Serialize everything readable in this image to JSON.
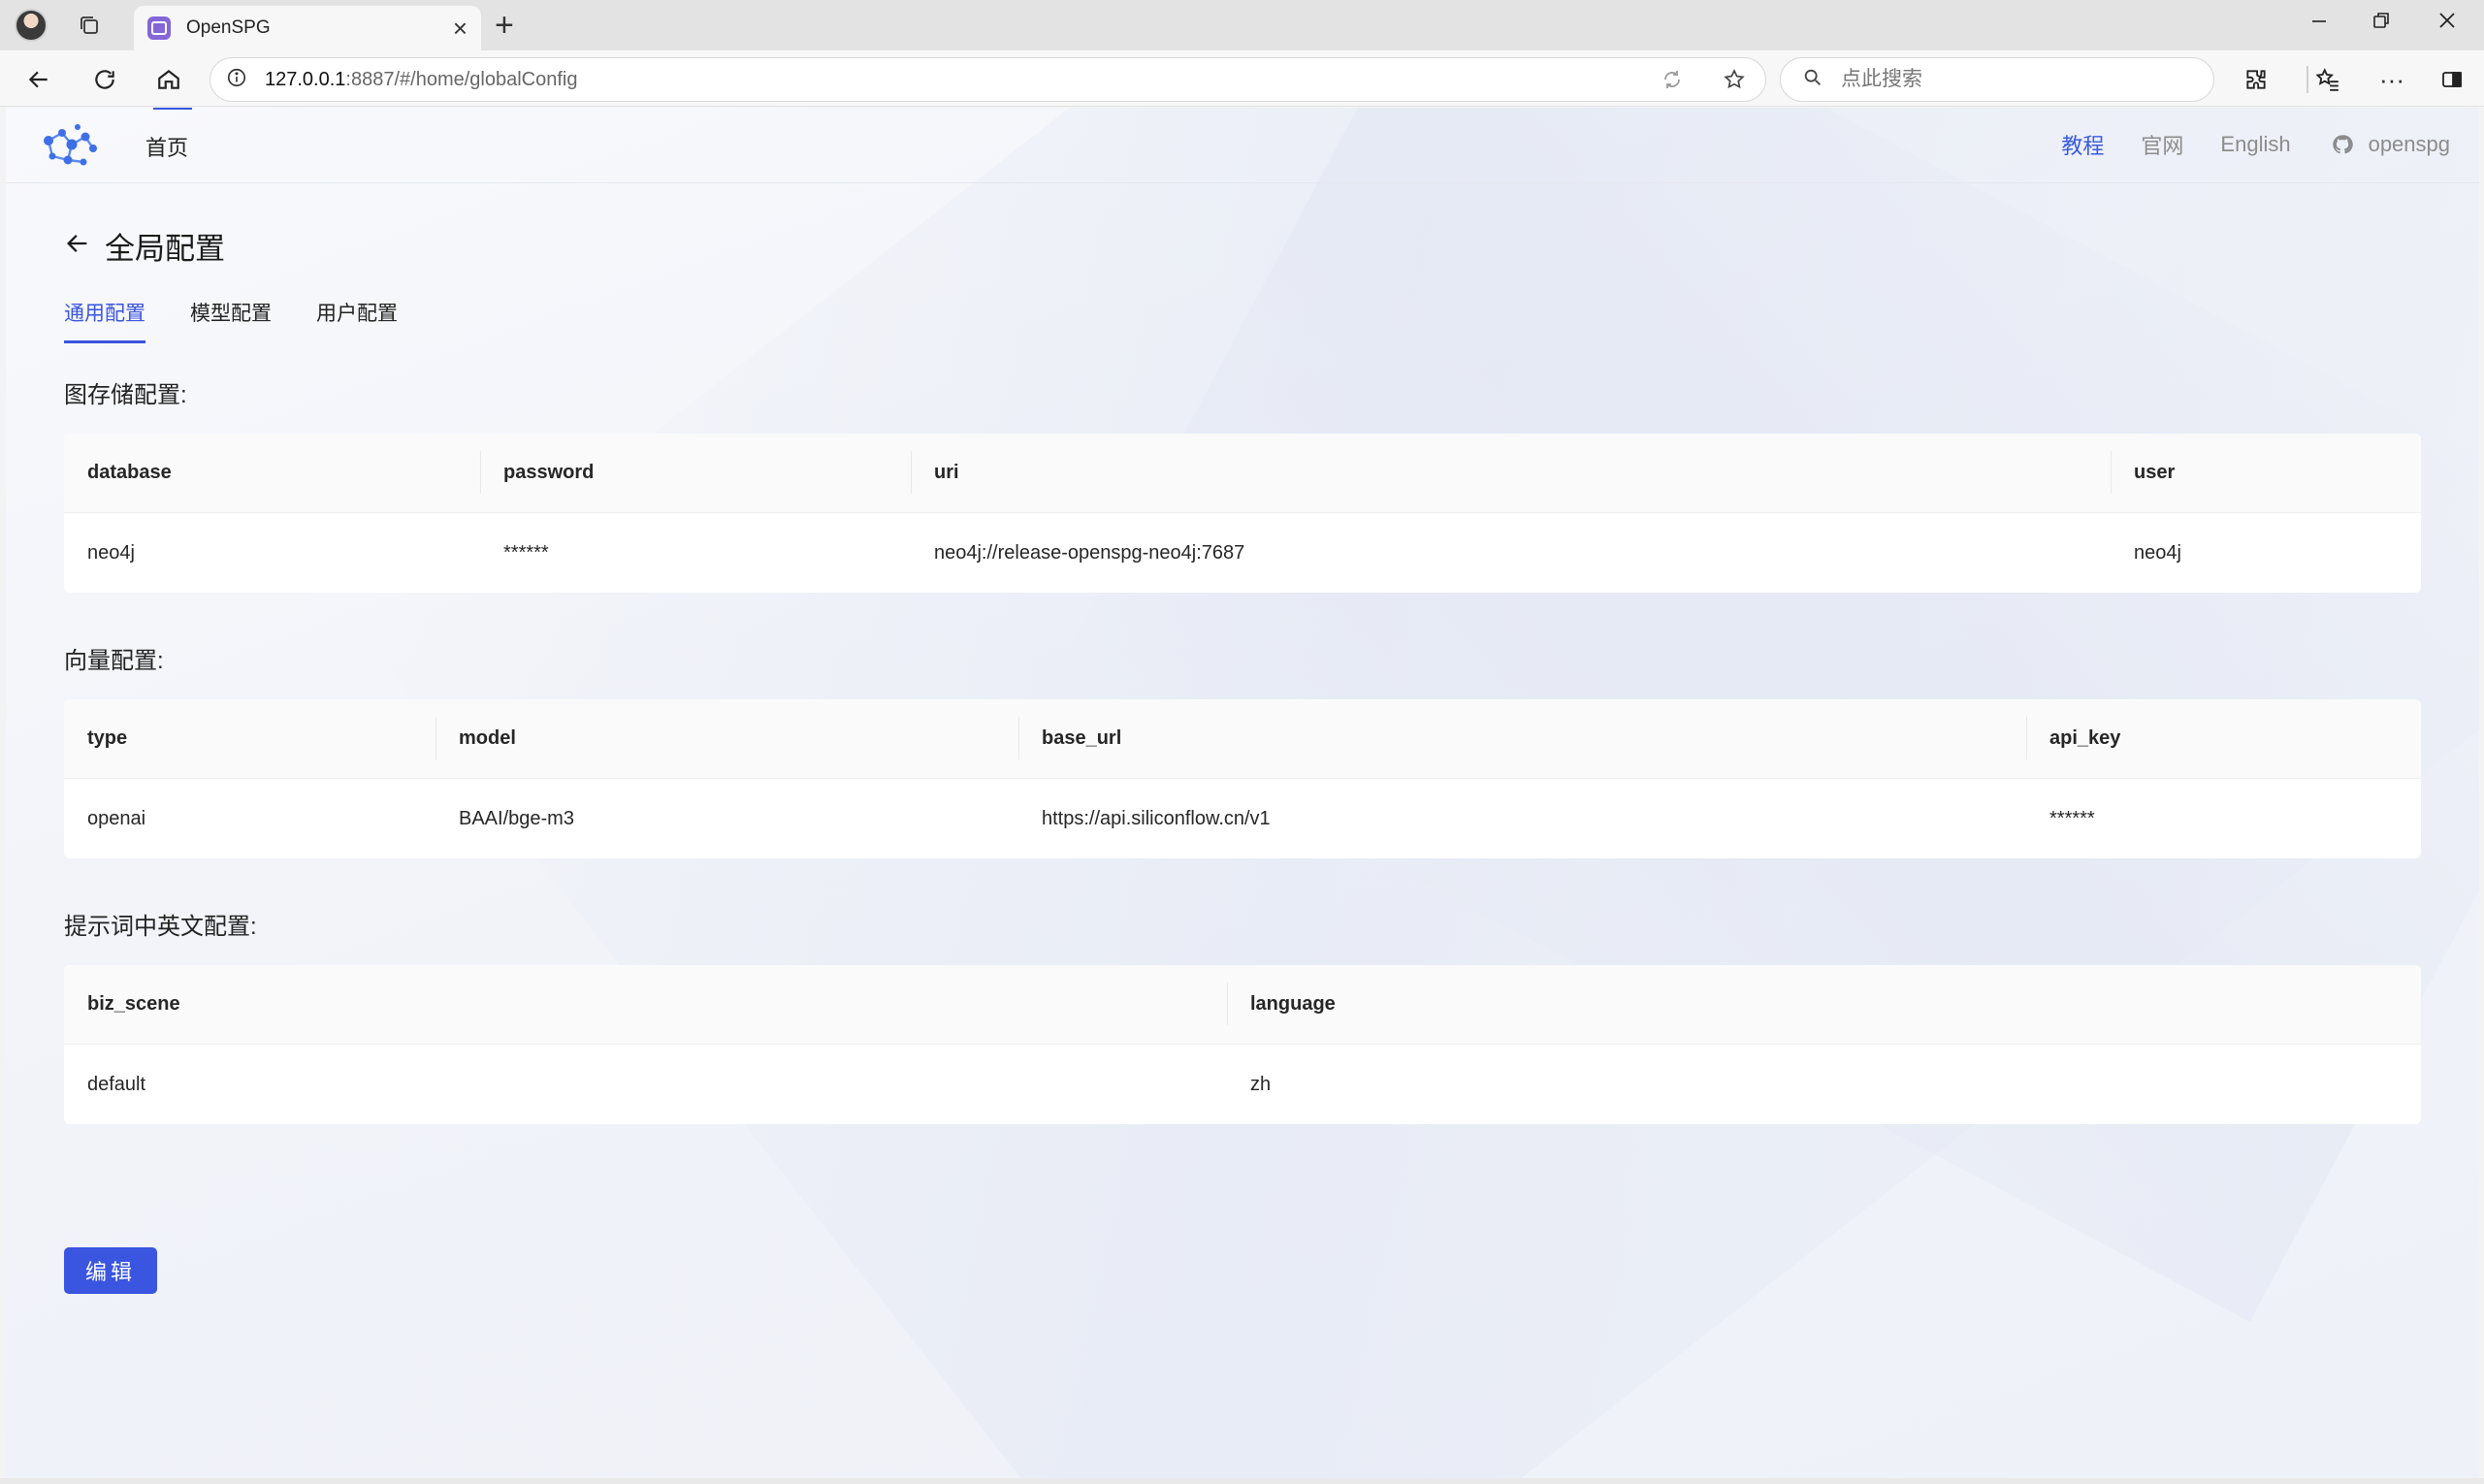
{
  "browser": {
    "tab_title": "OpenSPG",
    "url_host": "127.0.0.1",
    "url_rest": ":8887/#/home/globalConfig",
    "search_placeholder": "点此搜索"
  },
  "header": {
    "nav_home": "首页",
    "links": [
      "教程",
      "官网",
      "English"
    ],
    "user": "openspg"
  },
  "page": {
    "title": "全局配置",
    "tabs": [
      "通用配置",
      "模型配置",
      "用户配置"
    ],
    "active_tab": "通用配置"
  },
  "graph_store": {
    "title": "图存储配置:",
    "headers": [
      "database",
      "password",
      "uri",
      "user"
    ],
    "row": [
      "neo4j",
      "******",
      "neo4j://release-openspg-neo4j:7687",
      "neo4j"
    ]
  },
  "vector": {
    "title": "向量配置:",
    "headers": [
      "type",
      "model",
      "base_url",
      "api_key"
    ],
    "row": [
      "openai",
      "BAAI/bge-m3",
      "https://api.siliconflow.cn/v1",
      "******"
    ]
  },
  "prompt": {
    "title": "提示词中英文配置:",
    "headers": [
      "biz_scene",
      "language"
    ],
    "row": [
      "default",
      "zh"
    ]
  },
  "edit_button": "编辑",
  "colors": {
    "accent": "#3a55e0"
  }
}
